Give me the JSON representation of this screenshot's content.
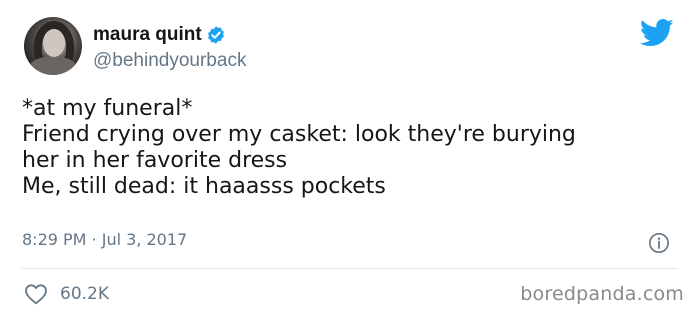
{
  "profile": {
    "name": "maura quint",
    "handle": "@behindyourback",
    "verified": true
  },
  "tweet": {
    "lines": [
      "*at my funeral*",
      "Friend crying over my casket: look they're burying",
      "her in her favorite dress",
      "Me, still dead: it haaasss pockets"
    ],
    "timestamp": "8:29 PM · Jul 3, 2017"
  },
  "stats": {
    "likes": "60.2K"
  },
  "watermark": "boredpanda.com",
  "icons": {
    "bird": "twitter-bird-icon",
    "verified": "verified-badge-icon",
    "info": "info-icon",
    "heart": "heart-icon"
  },
  "colors": {
    "brand_blue": "#1da1f2",
    "secondary_text": "#657786",
    "primary_text": "#14171a"
  }
}
